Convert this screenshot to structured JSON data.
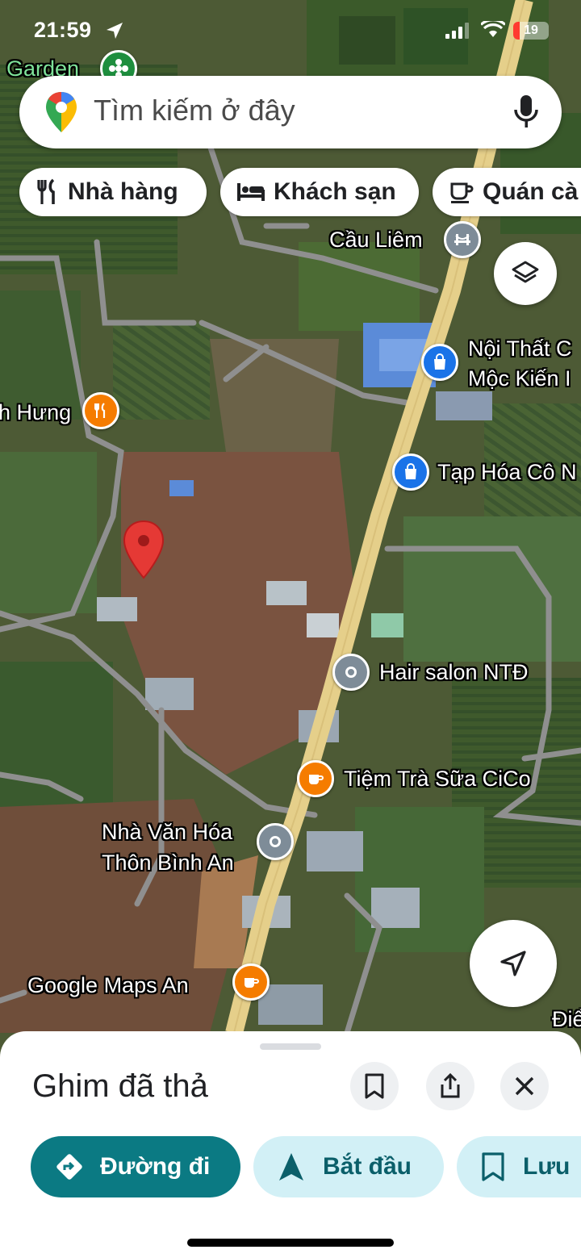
{
  "status_bar": {
    "time": "21:59",
    "battery_level": "19"
  },
  "search": {
    "placeholder": "Tìm kiếm ở đây"
  },
  "chips": [
    {
      "label": "Nhà hàng",
      "icon": "restaurant-icon"
    },
    {
      "label": "Khách sạn",
      "icon": "hotel-icon"
    },
    {
      "label": "Quán cà",
      "icon": "cafe-icon"
    }
  ],
  "map": {
    "labels": {
      "garden": "Garden",
      "cau_liem": "Cầu Liêm",
      "noi_that_line1": "Nội Thất C",
      "noi_that_line2": "Mộc Kiến I",
      "hung": "h Hưng",
      "tap_hoa": "Tạp Hóa Cô N",
      "hair_salon": "Hair salon NTĐ",
      "tiem_tra_sua": "Tiệm Trà Sữa CiCo",
      "nha_van_hoa_line1": "Nhà Văn Hóa",
      "nha_van_hoa_line2": "Thôn Bình An",
      "google_an": "Google Maps An",
      "die": "Điể"
    },
    "colors": {
      "main_road": "#e5cf8a",
      "minor_road": "#8f8f8f",
      "dropped_pin": "#e53935",
      "shopping_marker": "#1a73e8",
      "food_marker": "#f57c00",
      "generic_marker": "#7e8c98",
      "transit_marker": "#7e8c98"
    }
  },
  "sheet": {
    "title": "Ghim đã thả",
    "actions": {
      "directions": "Đường đi",
      "start": "Bắt đầu",
      "save": "Lưu"
    }
  },
  "theme": {
    "accent": "#0b7a83",
    "secondary_bg": "#d2f0f6",
    "secondary_text": "#0b5f6a"
  }
}
